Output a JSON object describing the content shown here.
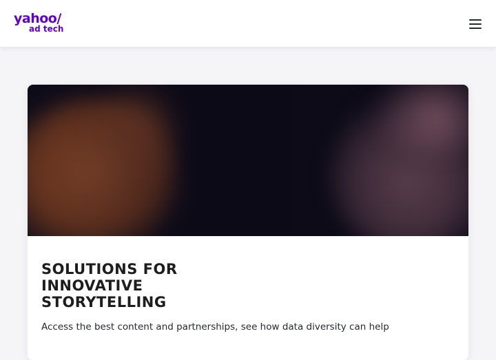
{
  "header": {
    "logo_main": "yahoo/",
    "logo_sub": "ad tech",
    "menu_icon": "hamburger-menu-icon"
  },
  "card": {
    "title": "SOLUTIONS FOR INNOVATIVE STORYTELLING",
    "description": "Access the best content and partnerships, see how data diversity can help"
  }
}
